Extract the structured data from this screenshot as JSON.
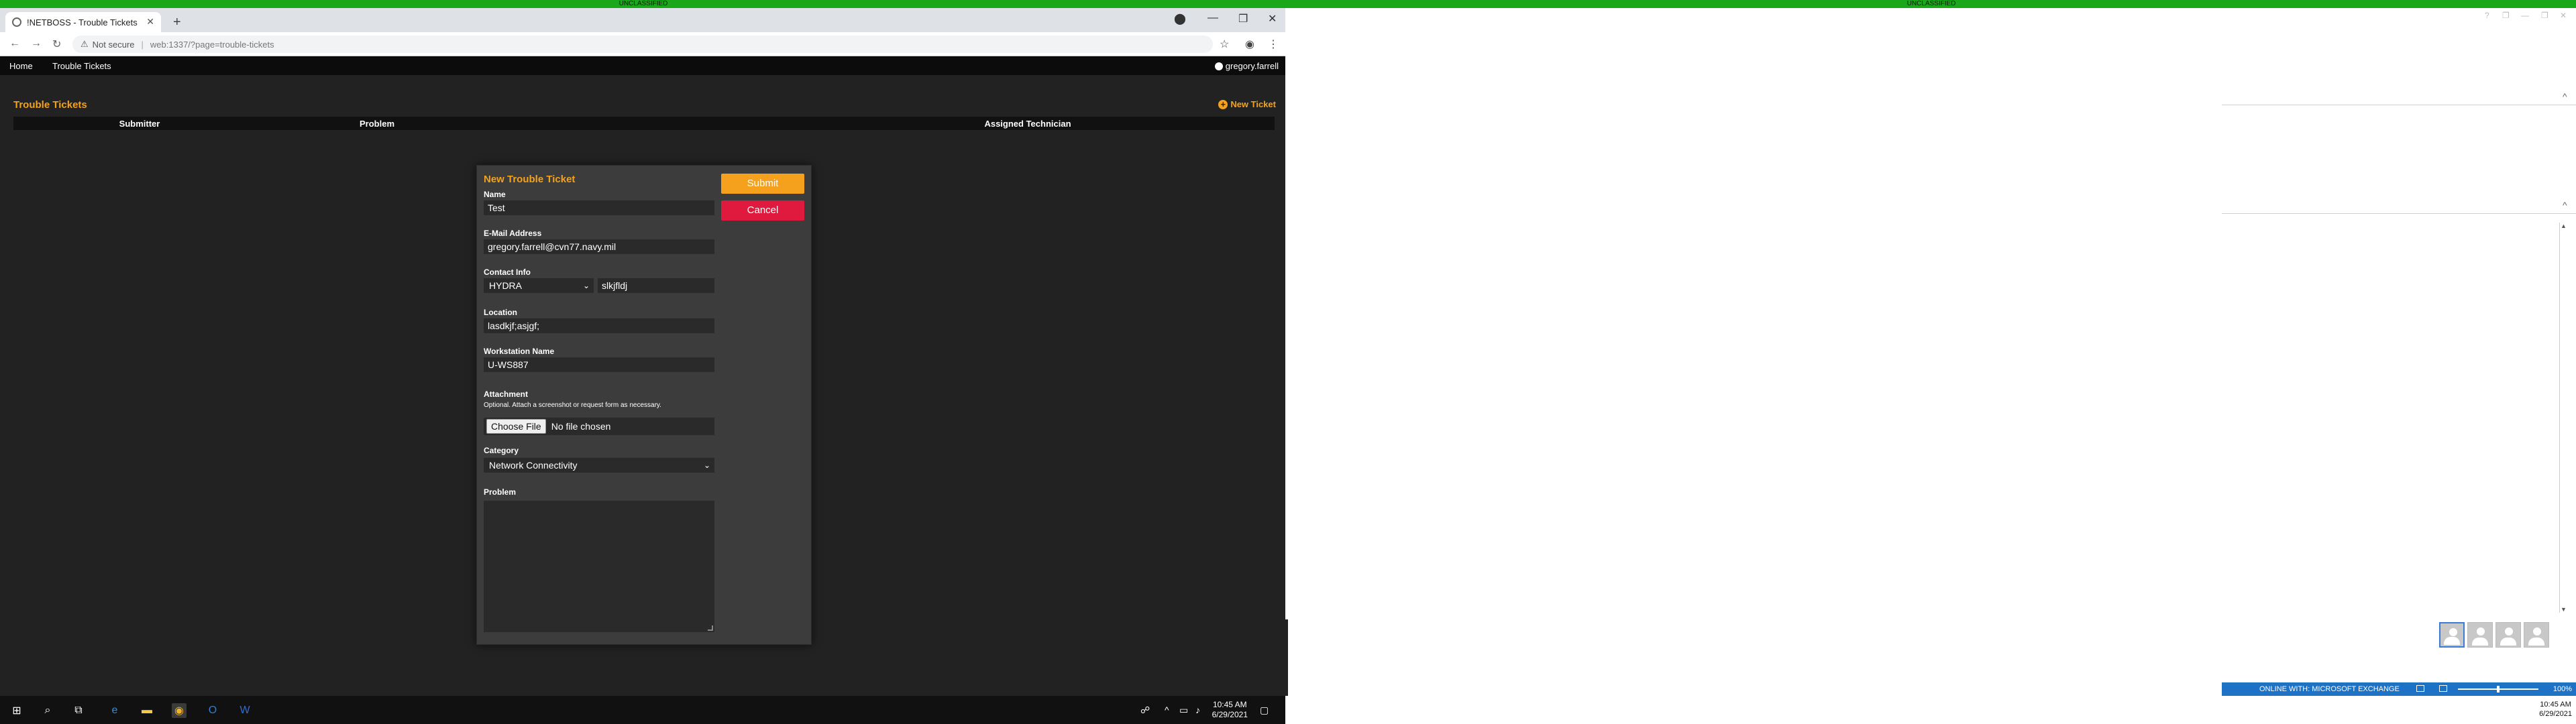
{
  "banner": {
    "left": "UNCLASSIFIED",
    "right": "UNCLASSIFIED"
  },
  "browser": {
    "tab_title": "!NETBOSS - Trouble Tickets",
    "security_label": "Not secure",
    "url": "web:1337/?page=trouble-tickets"
  },
  "nav": {
    "home": "Home",
    "trouble_tickets": "Trouble Tickets",
    "user": "gregory.farrell"
  },
  "page": {
    "title": "Trouble Tickets",
    "new_ticket": "New Ticket",
    "columns": [
      "Submitter",
      "Problem",
      "Assigned Technician"
    ]
  },
  "modal": {
    "title": "New Trouble Ticket",
    "name_label": "Name",
    "name_value": "Test",
    "email_label": "E-Mail Address",
    "email_value": "gregory.farrell@cvn77.navy.mil",
    "contact_label": "Contact Info",
    "contact_select": "HYDRA",
    "contact_value": "slkjfldj",
    "location_label": "Location",
    "location_value": "lasdkjf;asjgf;",
    "workstation_label": "Workstation Name",
    "workstation_value": "U-WS887",
    "attachment_label": "Attachment",
    "attachment_hint": "Optional. Attach a screenshot or request form as necessary.",
    "choose_file": "Choose File",
    "no_file": "No file chosen",
    "category_label": "Category",
    "category_value": "Network Connectivity",
    "problem_label": "Problem",
    "submit": "Submit",
    "cancel": "Cancel"
  },
  "taskbar": {
    "time": "10:45 AM",
    "date": "6/29/2021"
  },
  "outlook": {
    "status": "ONLINE WITH: MICROSOFT EXCHANGE",
    "zoom": "100%",
    "time": "10:45 AM",
    "date": "6/29/2021"
  }
}
